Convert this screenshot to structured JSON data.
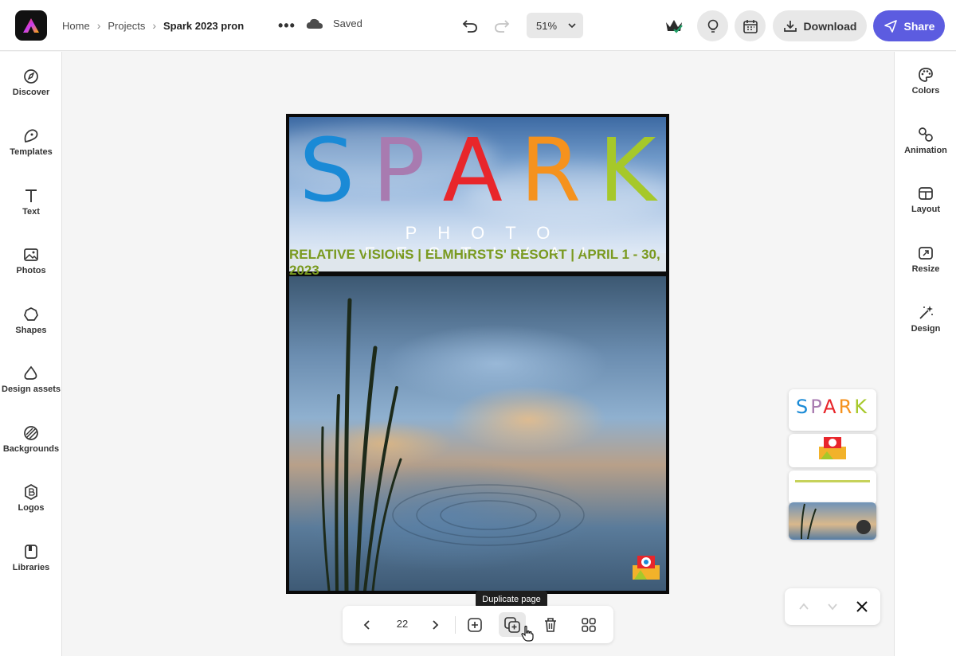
{
  "breadcrumb": {
    "home": "Home",
    "projects": "Projects",
    "current": "Spark 2023 pron"
  },
  "status": {
    "saved": "Saved"
  },
  "zoom": {
    "value": "51%"
  },
  "actions": {
    "download": "Download",
    "share": "Share"
  },
  "left_nav": [
    {
      "label": "Discover",
      "icon": "compass-icon"
    },
    {
      "label": "Templates",
      "icon": "templates-icon"
    },
    {
      "label": "Text",
      "icon": "text-icon"
    },
    {
      "label": "Photos",
      "icon": "photo-icon"
    },
    {
      "label": "Shapes",
      "icon": "shapes-icon"
    },
    {
      "label": "Design assets",
      "icon": "design-assets-icon"
    },
    {
      "label": "Backgrounds",
      "icon": "backgrounds-icon"
    },
    {
      "label": "Logos",
      "icon": "logos-icon"
    },
    {
      "label": "Libraries",
      "icon": "libraries-icon"
    }
  ],
  "right_nav": [
    {
      "label": "Colors",
      "icon": "palette-icon"
    },
    {
      "label": "Animation",
      "icon": "animation-icon"
    },
    {
      "label": "Layout",
      "icon": "layout-icon"
    },
    {
      "label": "Resize",
      "icon": "resize-icon"
    },
    {
      "label": "Design",
      "icon": "magic-wand-icon"
    }
  ],
  "poster": {
    "title_letters": [
      {
        "char": "S",
        "color": "#1a8ad6"
      },
      {
        "char": "P",
        "color": "#a87bb0"
      },
      {
        "char": "A",
        "color": "#e8262b"
      },
      {
        "char": "R",
        "color": "#f5921e"
      },
      {
        "char": "K",
        "color": "#a6c82a"
      }
    ],
    "subtitle": "PHOTO FESTIVAL",
    "info_bar": "RELATIVE VISIONS | ELMHIRSTS' RESORT | APRIL 1 - 30, 2023"
  },
  "page_toolbar": {
    "page_number": "22",
    "tooltip": "Duplicate page"
  },
  "thumbnails": {
    "first_title": "SPARK"
  }
}
